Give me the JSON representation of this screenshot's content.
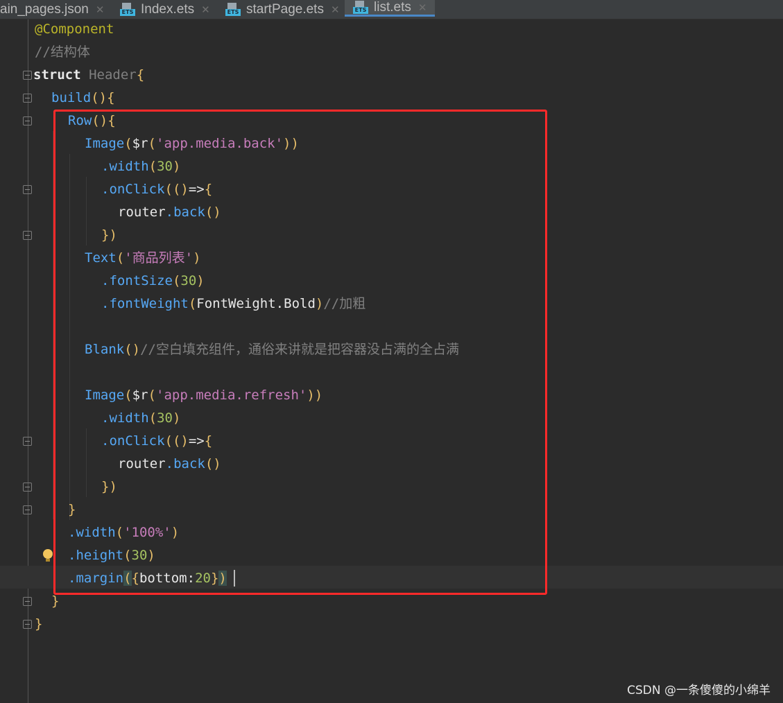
{
  "tabs": [
    {
      "label": "ain_pages.json",
      "active": false,
      "icon": "json-file-icon"
    },
    {
      "label": "Index.ets",
      "active": false,
      "icon": "ets-file-icon"
    },
    {
      "label": "startPage.ets",
      "active": false,
      "icon": "ets-file-icon"
    },
    {
      "label": "list.ets",
      "active": true,
      "icon": "ets-file-icon"
    }
  ],
  "ets_badge": "ETS",
  "close_glyph": "✕",
  "code": {
    "l1": "@Component",
    "l2": "//结构体",
    "l3_kw": "struct",
    "l3_name": "Header",
    "l4": "build",
    "l5": "Row",
    "l6_fn": "Image",
    "l6_r": "$r",
    "l6_str": "'app.media.back'",
    "l7_fn": ".width",
    "l7_num": "30",
    "l8_fn": ".onClick",
    "l9_obj": "router",
    "l9_fn": ".back",
    "l11_fn": "Text",
    "l11_str": "'商品列表'",
    "l12_fn": ".fontSize",
    "l12_num": "30",
    "l13_fn": ".fontWeight",
    "l13_arg": "FontWeight.Bold",
    "l13_cmt": "//加粗",
    "l15_fn": "Blank",
    "l15_cmt": "//空白填充组件，通俗来讲就是把容器没占满的全占满",
    "l17_fn": "Image",
    "l17_r": "$r",
    "l17_str": "'app.media.refresh'",
    "l18_fn": ".width",
    "l18_num": "30",
    "l19_fn": ".onClick",
    "l20_obj": "router",
    "l20_fn": ".back",
    "l23_fn": ".width",
    "l23_str": "'100%'",
    "l24_fn": ".height",
    "l24_num": "30",
    "l25_fn": ".margin",
    "l25_key": "bottom",
    "l25_num": "20"
  },
  "watermark": "CSDN @一条傻傻的小绵羊",
  "colors": {
    "editor_bg": "#2b2b2b",
    "highlight_box": "#ff2a2a",
    "tab_active_underline": "#4a88c7"
  }
}
